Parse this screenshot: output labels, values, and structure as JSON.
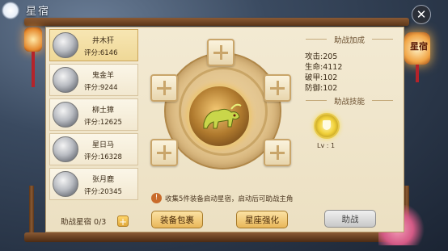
{
  "window": {
    "title": "星宿",
    "close_label": "✕"
  },
  "constellation_list": [
    {
      "name": "井木犴",
      "score": "评分:6146",
      "selected": true
    },
    {
      "name": "鬼金羊",
      "score": "评分:9244",
      "selected": false
    },
    {
      "name": "柳土獐",
      "score": "评分:12625",
      "selected": false
    },
    {
      "name": "星日马",
      "score": "评分:16328",
      "selected": false
    },
    {
      "name": "张月鹿",
      "score": "评分:20345",
      "selected": false
    }
  ],
  "list_footer": {
    "label": "助战星宿 0/3",
    "add_label": "+"
  },
  "side_badge": "星宿",
  "notice": {
    "icon": "!",
    "text": "收集5件装备启动星宿，启动后可助战主角"
  },
  "buttons": {
    "equip_bag": "装备包裹",
    "star_enhance": "星座强化",
    "assist": "助战"
  },
  "assist_bonus": {
    "title": "助战加成",
    "stats": [
      "攻击:205",
      "生命:4112",
      "破甲:102",
      "防御:102"
    ]
  },
  "assist_skill": {
    "title": "助战技能",
    "level": "Lv : 1",
    "icon": "shield-icon"
  }
}
